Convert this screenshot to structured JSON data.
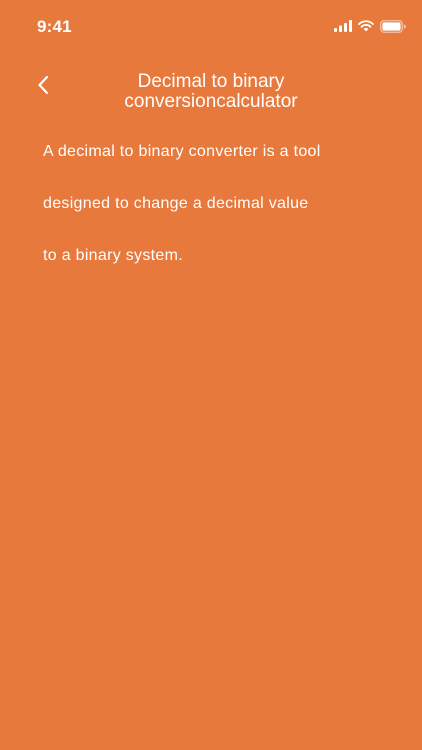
{
  "status_bar": {
    "time": "9:41",
    "icons": [
      "signal-icon",
      "wifi-icon",
      "battery-icon"
    ]
  },
  "header": {
    "back_icon": "chevron-left-icon",
    "title_line1": "Decimal to binary",
    "title_line2": "conversioncalculator"
  },
  "content": {
    "description_lines": [
      "A decimal to binary converter is a tool",
      "designed to change a decimal value",
      "to a binary system."
    ]
  },
  "colors": {
    "background": "#E8793C",
    "text": "#FFFFFF"
  }
}
